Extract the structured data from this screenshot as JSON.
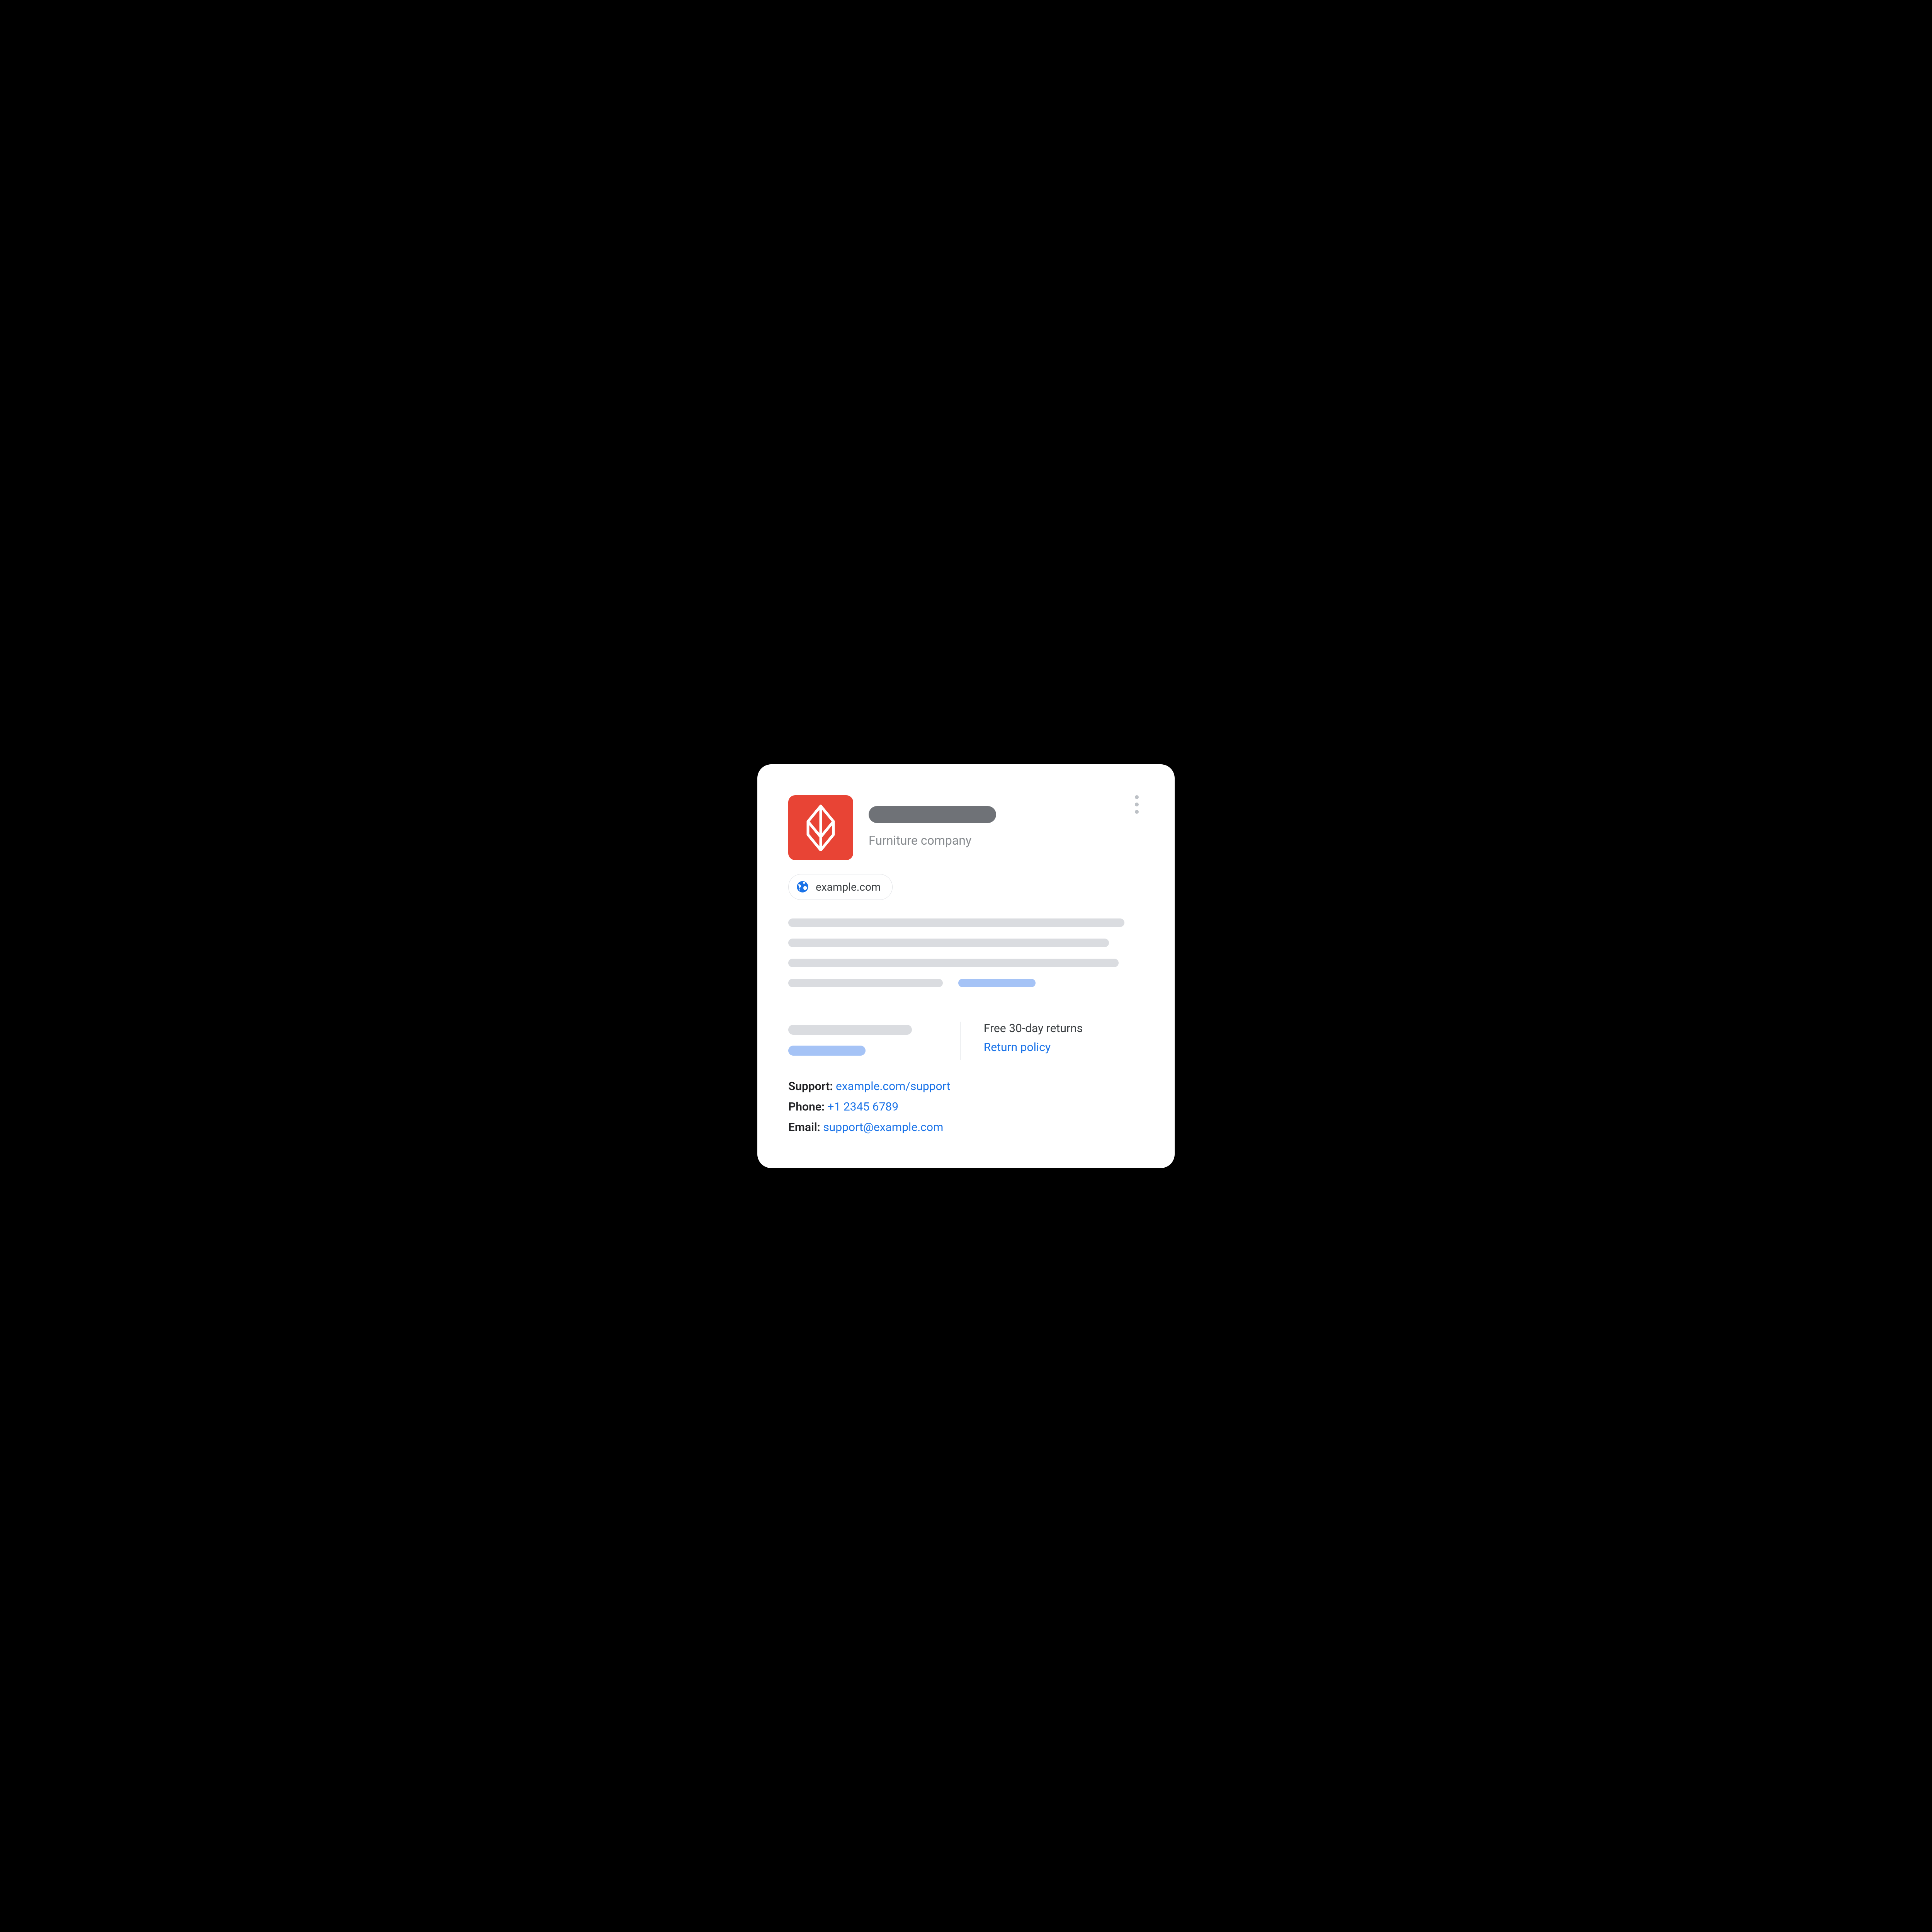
{
  "header": {
    "subtitle": "Furniture company"
  },
  "website_chip": {
    "domain": "example.com"
  },
  "returns": {
    "text": "Free 30-day returns",
    "policy_link_label": "Return policy"
  },
  "contact": {
    "support_label": "Support:",
    "support_link": "example.com/support",
    "phone_label": "Phone:",
    "phone_value": "+1 2345 6789",
    "email_label": "Email:",
    "email_value": "support@example.com"
  }
}
